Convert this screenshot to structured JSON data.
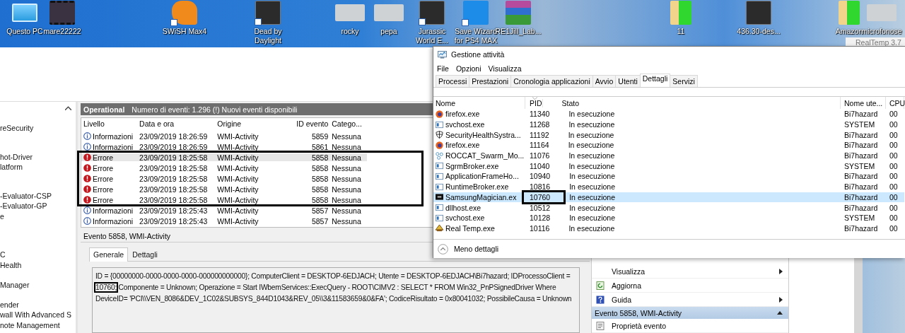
{
  "desktop": {
    "icons": [
      {
        "label": "Questo PC",
        "kind": "pc",
        "shortcut": false
      },
      {
        "label": "mare22222",
        "kind": "video",
        "shortcut": false
      },
      {
        "label": "SWiSH Max4",
        "kind": "orange",
        "shortcut": true
      },
      {
        "label": "Dead by Daylight",
        "kind": "dark",
        "shortcut": true
      },
      {
        "label": "rocky",
        "kind": "photo",
        "shortcut": false
      },
      {
        "label": "pepa",
        "kind": "photo",
        "shortcut": false
      },
      {
        "label": "Jurassic World E...",
        "kind": "dark",
        "shortcut": true
      },
      {
        "label": "Save Wizard for PS4 MAX",
        "kind": "blue",
        "shortcut": true
      },
      {
        "label": "RE1Jill_Lab...",
        "kind": "archive",
        "shortcut": false
      },
      {
        "label": "11",
        "kind": "folder",
        "shortcut": false
      },
      {
        "label": "436.30-des...",
        "kind": "installer",
        "shortcut": false
      },
      {
        "label": "Amazon",
        "kind": "folder",
        "shortcut": false
      },
      {
        "label": "microfonose",
        "kind": "photo",
        "shortcut": false
      }
    ],
    "background_window_title": "RealTemp 3.7"
  },
  "event_viewer": {
    "nav_items": [
      "reSecurity",
      "hot-Driver",
      "latform",
      "-Evaluator-CSP",
      "-Evaluator-GP",
      "e",
      "C",
      "Health",
      "Manager",
      "ender",
      "wall With Advanced S",
      "note Management"
    ],
    "log_header": {
      "name": "Operational",
      "info": "Numero di eventi: 1.296 (!) Nuovi eventi disponibili"
    },
    "columns": [
      "Livello",
      "Data e ora",
      "Origine",
      "ID evento",
      "Catego..."
    ],
    "events": [
      {
        "level": "Informazioni",
        "kind": "info",
        "date": "23/09/2019 18:26:59",
        "source": "WMI-Activity",
        "id": "5859",
        "category": "Nessuna",
        "selected": false
      },
      {
        "level": "Informazioni",
        "kind": "info",
        "date": "23/09/2019 18:26:59",
        "source": "WMI-Activity",
        "id": "5861",
        "category": "Nessuna",
        "selected": false
      },
      {
        "level": "Errore",
        "kind": "error",
        "date": "23/09/2019 18:25:58",
        "source": "WMI-Activity",
        "id": "5858",
        "category": "Nessuna",
        "selected": true
      },
      {
        "level": "Errore",
        "kind": "error",
        "date": "23/09/2019 18:25:58",
        "source": "WMI-Activity",
        "id": "5858",
        "category": "Nessuna",
        "selected": false
      },
      {
        "level": "Errore",
        "kind": "error",
        "date": "23/09/2019 18:25:58",
        "source": "WMI-Activity",
        "id": "5858",
        "category": "Nessuna",
        "selected": false
      },
      {
        "level": "Errore",
        "kind": "error",
        "date": "23/09/2019 18:25:58",
        "source": "WMI-Activity",
        "id": "5858",
        "category": "Nessuna",
        "selected": false
      },
      {
        "level": "Errore",
        "kind": "error",
        "date": "23/09/2019 18:25:58",
        "source": "WMI-Activity",
        "id": "5858",
        "category": "Nessuna",
        "selected": false
      },
      {
        "level": "Informazioni",
        "kind": "info",
        "date": "23/09/2019 18:25:43",
        "source": "WMI-Activity",
        "id": "5857",
        "category": "Nessuna",
        "selected": false
      },
      {
        "level": "Informazioni",
        "kind": "info",
        "date": "23/09/2019 18:25:43",
        "source": "WMI-Activity",
        "id": "5857",
        "category": "Nessuna",
        "selected": false
      }
    ],
    "detail": {
      "title": "Evento 5858, WMI-Activity",
      "tabs": [
        {
          "label": "Generale",
          "selected": true
        },
        {
          "label": "Dettagli",
          "selected": false
        }
      ],
      "text": "ID = {00000000-0000-0000-0000-000000000000}; ComputerClient = DESKTOP-6EDJACH; Utente = DESKTOP-6EDJACH\\Bi7hazard; IDProcessoClient = **10760;** Componente = Unknown; Operazione = Start IWbemServices::ExecQuery - ROOT\\CIMV2 : SELECT * FROM Win32_PnPSignedDriver Where DeviceID= 'PCI\\\\VEN_8086&DEV_1C02&SUBSYS_844D1043&REV_05\\\\3&11583659&0&FA'; CodiceRisultato = 0x80041032; PossibileCausa = Unknown"
    },
    "actions": [
      {
        "label": "Visualizza",
        "kind": "submenu"
      },
      {
        "label": "Aggiorna",
        "kind": "refresh"
      },
      {
        "label": "Guida",
        "kind": "help"
      }
    ],
    "actions_section": {
      "title": "Evento 5858, WMI-Activity",
      "items": [
        {
          "label": "Proprietà evento",
          "kind": "properties"
        }
      ]
    }
  },
  "task_manager": {
    "title": "Gestione attività",
    "menu": [
      "File",
      "Opzioni",
      "Visualizza"
    ],
    "tabs": [
      {
        "label": "Processi",
        "selected": false
      },
      {
        "label": "Prestazioni",
        "selected": false
      },
      {
        "label": "Cronologia applicazioni",
        "selected": false
      },
      {
        "label": "Avvio",
        "selected": false
      },
      {
        "label": "Utenti",
        "selected": false
      },
      {
        "label": "Dettagli",
        "selected": true
      },
      {
        "label": "Servizi",
        "selected": false
      }
    ],
    "columns": [
      "Nome",
      "PID",
      "Stato",
      "Nome ute...",
      "CPU"
    ],
    "processes": [
      {
        "name": "firefox.exe",
        "kind": "firefox",
        "pid": "11340",
        "status": "In esecuzione",
        "user": "Bi7hazard",
        "cpu": "00",
        "selected": false
      },
      {
        "name": "svchost.exe",
        "kind": "service",
        "pid": "11268",
        "status": "In esecuzione",
        "user": "SYSTEM",
        "cpu": "00",
        "selected": false
      },
      {
        "name": "SecurityHealthSystra...",
        "kind": "shield",
        "pid": "11192",
        "status": "In esecuzione",
        "user": "Bi7hazard",
        "cpu": "00",
        "selected": false
      },
      {
        "name": "firefox.exe",
        "kind": "firefox",
        "pid": "11164",
        "status": "In esecuzione",
        "user": "Bi7hazard",
        "cpu": "00",
        "selected": false
      },
      {
        "name": "ROCCAT_Swarm_Mo...",
        "kind": "roccat",
        "pid": "11076",
        "status": "In esecuzione",
        "user": "Bi7hazard",
        "cpu": "00",
        "selected": false
      },
      {
        "name": "SgrmBroker.exe",
        "kind": "service",
        "pid": "11040",
        "status": "In esecuzione",
        "user": "SYSTEM",
        "cpu": "00",
        "selected": false
      },
      {
        "name": "ApplicationFrameHo...",
        "kind": "service",
        "pid": "10940",
        "status": "In esecuzione",
        "user": "Bi7hazard",
        "cpu": "00",
        "selected": false
      },
      {
        "name": "RuntimeBroker.exe",
        "kind": "service",
        "pid": "10816",
        "status": "In esecuzione",
        "user": "Bi7hazard",
        "cpu": "00",
        "selected": false
      },
      {
        "name": "SamsungMagician.ex",
        "kind": "ssd",
        "pid": "10760",
        "status": "In esecuzione",
        "user": "Bi7hazard",
        "cpu": "00",
        "selected": true
      },
      {
        "name": "dllhost.exe",
        "kind": "service",
        "pid": "10512",
        "status": "In esecuzione",
        "user": "Bi7hazard",
        "cpu": "00",
        "selected": false
      },
      {
        "name": "svchost.exe",
        "kind": "service",
        "pid": "10128",
        "status": "In esecuzione",
        "user": "SYSTEM",
        "cpu": "00",
        "selected": false
      },
      {
        "name": "Real Temp.exe",
        "kind": "realtemp",
        "pid": "10116",
        "status": "In esecuzione",
        "user": "Bi7hazard",
        "cpu": "00",
        "selected": false
      }
    ],
    "footer": "Meno dettagli"
  }
}
